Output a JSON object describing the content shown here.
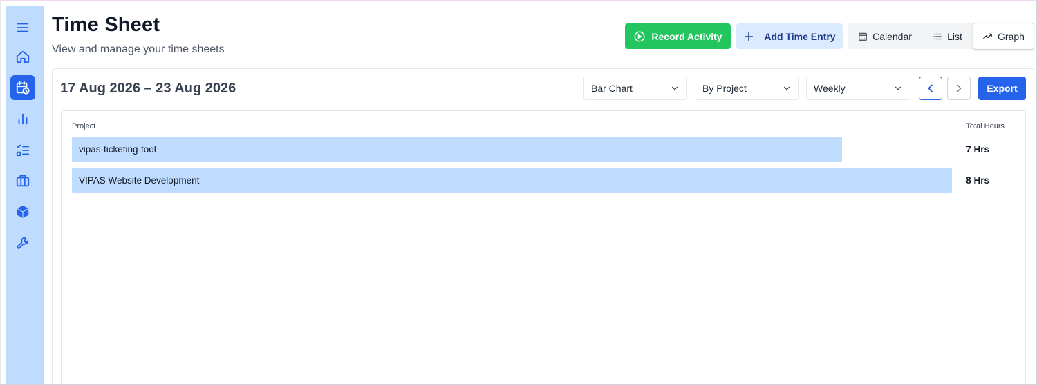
{
  "header": {
    "title": "Time Sheet",
    "subtitle": "View and manage your time sheets"
  },
  "actions": {
    "record_label": "Record Activity",
    "add_label": "Add Time Entry"
  },
  "views": {
    "calendar_label": "Calendar",
    "list_label": "List",
    "graph_label": "Graph",
    "active": "Graph"
  },
  "report": {
    "date_range": "17 Aug 2026 – 23 Aug 2026",
    "chart_type": "Bar Chart",
    "group_by": "By Project",
    "period": "Weekly",
    "export_label": "Export"
  },
  "sidebar": {
    "items": [
      {
        "icon": "menu-icon"
      },
      {
        "icon": "home-icon"
      },
      {
        "icon": "calendar-clock-icon",
        "active": true
      },
      {
        "icon": "bar-chart-icon"
      },
      {
        "icon": "checklist-icon"
      },
      {
        "icon": "briefcase-icon"
      },
      {
        "icon": "cube-icon"
      },
      {
        "icon": "wrench-icon"
      }
    ]
  },
  "colors": {
    "accent": "#2563eb",
    "record": "#22c55e",
    "bar": "#bfdbfe",
    "sidebar": "#bfdbfe"
  },
  "chart_data": {
    "type": "bar",
    "orientation": "horizontal",
    "header_category": "Project",
    "header_value": "Total Hours",
    "categories": [
      "vipas-ticketing-tool",
      "VIPAS Website Development"
    ],
    "values": [
      7,
      8
    ],
    "value_labels": [
      "7 Hrs",
      "8 Hrs"
    ],
    "xlim": [
      0,
      8
    ]
  }
}
